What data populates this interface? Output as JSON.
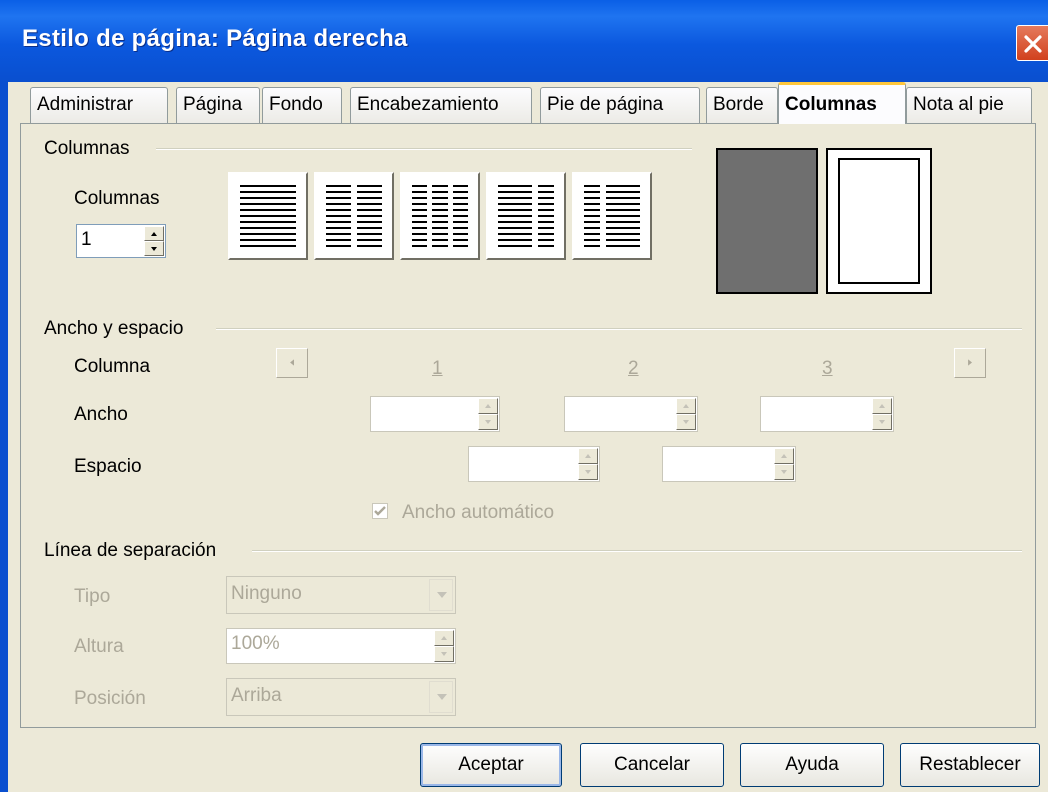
{
  "window": {
    "title": "Estilo de página: Página derecha",
    "close_icon": "close-icon"
  },
  "tabs": [
    {
      "label": "Administrar",
      "active": false
    },
    {
      "label": "Página",
      "active": false
    },
    {
      "label": "Fondo",
      "active": false
    },
    {
      "label": "Encabezamiento",
      "active": false
    },
    {
      "label": "Pie de página",
      "active": false
    },
    {
      "label": "Borde",
      "active": false
    },
    {
      "label": "Columnas",
      "active": true
    },
    {
      "label": "Nota al pie",
      "active": false
    }
  ],
  "columns_section": {
    "group_label": "Columnas",
    "columns_label": "Columnas",
    "columns_value": "1",
    "presets": [
      "1-column",
      "2-columns",
      "3-columns",
      "2-columns-left-wide",
      "2-columns-right-wide"
    ]
  },
  "width_spacing": {
    "group_label": "Ancho y espacio",
    "column_label": "Columna",
    "width_label": "Ancho",
    "spacing_label": "Espacio",
    "column_numbers": [
      "1",
      "2",
      "3"
    ],
    "width_values": [
      "",
      "",
      ""
    ],
    "spacing_values": [
      "",
      ""
    ],
    "auto_width_label": "Ancho automático",
    "auto_width_checked": true,
    "prev_icon": "arrow-left-icon",
    "next_icon": "arrow-right-icon"
  },
  "separator": {
    "group_label": "Línea de separación",
    "type_label": "Tipo",
    "type_value": "Ninguno",
    "height_label": "Altura",
    "height_value": "100%",
    "position_label": "Posición",
    "position_value": "Arriba"
  },
  "buttons": {
    "ok": "Aceptar",
    "cancel": "Cancelar",
    "help": "Ayuda",
    "reset": "Restablecer"
  },
  "colors": {
    "titlebar": "#0a5fe6",
    "dialog_bg": "#ece9d8",
    "preview_fill": "#6f6f6f",
    "active_tab_accent": "#ffc73c"
  }
}
